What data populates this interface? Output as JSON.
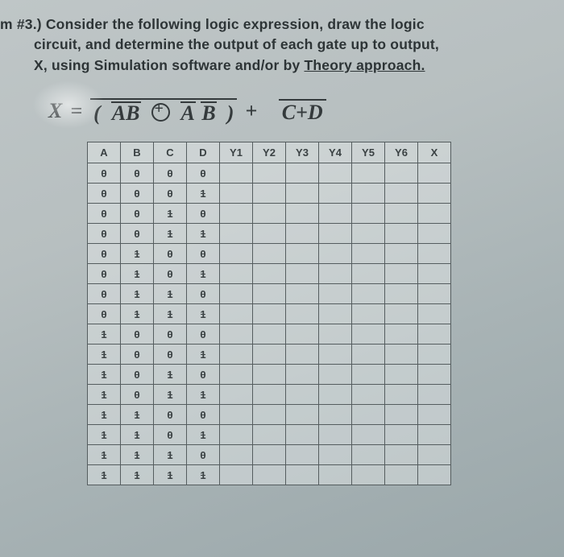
{
  "problem": {
    "number": "m #3.)",
    "line1": "Consider the following logic expression, draw the logic",
    "line2": "circuit, and determine the output of each gate up to output,",
    "line3_a": "X, using Simulation software and/or by ",
    "line3_b": "Theory approach.",
    "theory_underlined": true
  },
  "equation": {
    "lhs": "X",
    "eq": "=",
    "open": "(",
    "term1": "AB",
    "op_xor": "⊕",
    "term2_a": "A",
    "term2_b": "B",
    "close": ")",
    "plus": "+",
    "term3": "C+D"
  },
  "table": {
    "headers": [
      "A",
      "B",
      "C",
      "D",
      "Y1",
      "Y2",
      "Y3",
      "Y4",
      "Y5",
      "Y6",
      "X"
    ],
    "rows": [
      [
        "0",
        "0",
        "0",
        "0",
        "",
        "",
        "",
        "",
        "",
        "",
        ""
      ],
      [
        "0",
        "0",
        "0",
        "1",
        "",
        "",
        "",
        "",
        "",
        "",
        ""
      ],
      [
        "0",
        "0",
        "1",
        "0",
        "",
        "",
        "",
        "",
        "",
        "",
        ""
      ],
      [
        "0",
        "0",
        "1",
        "1",
        "",
        "",
        "",
        "",
        "",
        "",
        ""
      ],
      [
        "0",
        "1",
        "0",
        "0",
        "",
        "",
        "",
        "",
        "",
        "",
        ""
      ],
      [
        "0",
        "1",
        "0",
        "1",
        "",
        "",
        "",
        "",
        "",
        "",
        ""
      ],
      [
        "0",
        "1",
        "1",
        "0",
        "",
        "",
        "",
        "",
        "",
        "",
        ""
      ],
      [
        "0",
        "1",
        "1",
        "1",
        "",
        "",
        "",
        "",
        "",
        "",
        ""
      ],
      [
        "1",
        "0",
        "0",
        "0",
        "",
        "",
        "",
        "",
        "",
        "",
        ""
      ],
      [
        "1",
        "0",
        "0",
        "1",
        "",
        "",
        "",
        "",
        "",
        "",
        ""
      ],
      [
        "1",
        "0",
        "1",
        "0",
        "",
        "",
        "",
        "",
        "",
        "",
        ""
      ],
      [
        "1",
        "0",
        "1",
        "1",
        "",
        "",
        "",
        "",
        "",
        "",
        ""
      ],
      [
        "1",
        "1",
        "0",
        "0",
        "",
        "",
        "",
        "",
        "",
        "",
        ""
      ],
      [
        "1",
        "1",
        "0",
        "1",
        "",
        "",
        "",
        "",
        "",
        "",
        ""
      ],
      [
        "1",
        "1",
        "1",
        "0",
        "",
        "",
        "",
        "",
        "",
        "",
        ""
      ],
      [
        "1",
        "1",
        "1",
        "1",
        "",
        "",
        "",
        "",
        "",
        "",
        ""
      ]
    ]
  }
}
